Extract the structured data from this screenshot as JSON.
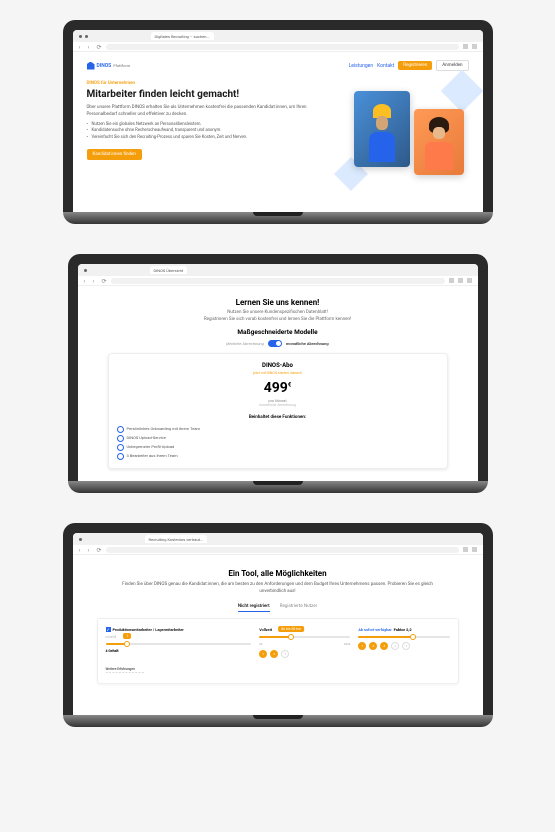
{
  "mockup1": {
    "browser_tab": "Digitales Recruiting – suchen...",
    "nav": {
      "brand": "DINOS",
      "brand_sub": "Plattform",
      "link_services": "Leistungen",
      "link_contact": "Kontakt",
      "btn_register": "Registrieren",
      "btn_login": "Anmelden"
    },
    "hero": {
      "preheading": "DINOS für Unternehmen",
      "headline": "Mitarbeiter finden leicht gemacht!",
      "body": "Über unsere Plattform DINOS erhalten Sie als Unternehmen kostenfrei die passenden Kandidat:innen, um Ihren Personalbedarf schneller und effektiver zu decken.",
      "bullets": [
        "Nutzen Sie ein globales Netzwerk an Personaldiensleistern.",
        "Kandidatensuche ohne Recherscheaufwand, transparent und anonym.",
        "Vereinfacht Sie sich den Recruiting-Prozess und sparen Sie Kosten, Zeit und Nerven."
      ],
      "cta": "Kandidat:innen finden"
    }
  },
  "mockup2": {
    "browser_tab": "DINOS Übersicht",
    "h2": "Lernen Sie uns kennen!",
    "sub1": "Nutzen Sie unsere Kundenspezifischen Datenblatt!",
    "sub2": "Registrieren Sie sich vorab kostenfrei und lernen Sie die Plattform kennen!",
    "h3": "Maßgeschneiderte Modelle",
    "toggle_left": "jährliche Abrechnung",
    "toggle_right": "monatliche Abrechnung",
    "plan": {
      "name": "DINOS-Abo",
      "tagline": "jetzt mit DINOS starten, danach",
      "price": "499",
      "currency": "€",
      "period": "pro Monat",
      "period_note": "monatliche Abrechnung",
      "features_title": "Beinhaltet diese Funktionen:",
      "features": [
        "Persönliches Onboarding mit Ihrem Team",
        "DINOS Upload-Service",
        "Unbegrenzter Profil-Upload",
        "3 Bearbeiter aus Ihrem Team"
      ]
    }
  },
  "mockup3": {
    "browser_tab": "Recruiting Kostenlos vertraut...",
    "h2": "Ein Tool, alle Möglichkeiten",
    "body": "Finden Sie über DINOS genau die Kandidat:innen, die am besten zu den Anforderungen und dem Budget Ihres Unternehmens passen. Probieren Sie es gleich unverbindlich aus!",
    "tab_unreg": "Nicht registriert",
    "tab_reg": "Registrierte Nutzer",
    "calc": {
      "col1_label": "Produktionsmitarbeiter / Lagermitarbeiter",
      "col1_meta": "m/w/d",
      "col2_label": "Vollzeit",
      "col2_slider_min": "0k",
      "col2_slider_max": "200k",
      "col2_value": "8k bis 50 km",
      "col3_label": "Ab sofort verfügbar",
      "col3_faktor": "Faktor 2,2",
      "gehalt_label": "4 Gehalt",
      "misc_title": "Weitere Erfahrungen"
    }
  }
}
